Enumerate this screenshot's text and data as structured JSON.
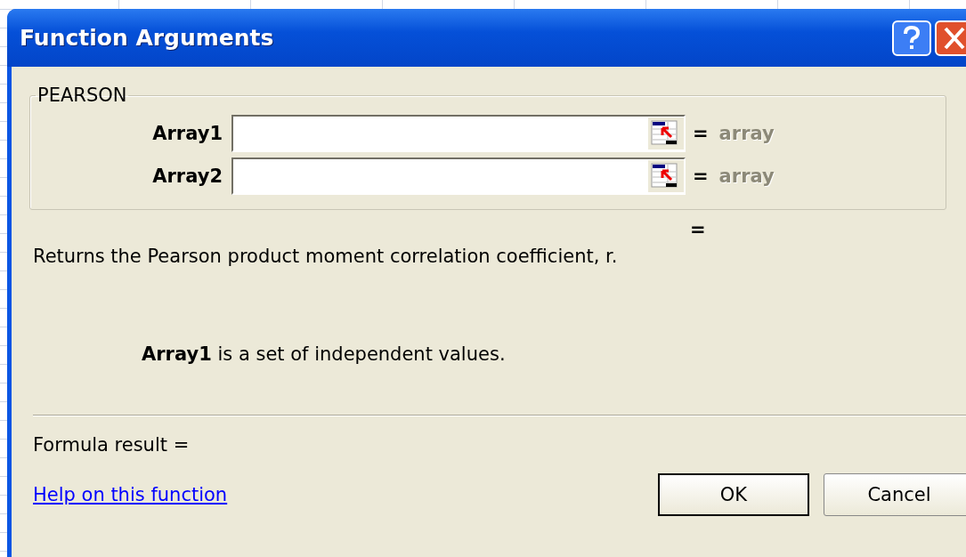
{
  "window": {
    "title": "Function Arguments"
  },
  "function_group": {
    "title": "PEARSON",
    "arguments": [
      {
        "label": "Array1",
        "equals": "=",
        "type_hint": "array"
      },
      {
        "label": "Array2",
        "equals": "=",
        "type_hint": "array"
      }
    ]
  },
  "result_equals": "=",
  "description": "Returns the Pearson product moment correlation coefficient, r.",
  "argument_help": "**Array1** is a set of independent values.",
  "formula_result": "Formula result =",
  "help_link": "Help on this function",
  "buttons": [
    {
      "label": "OK",
      "default": true
    },
    {
      "label": "Cancel",
      "default": false
    }
  ]
}
